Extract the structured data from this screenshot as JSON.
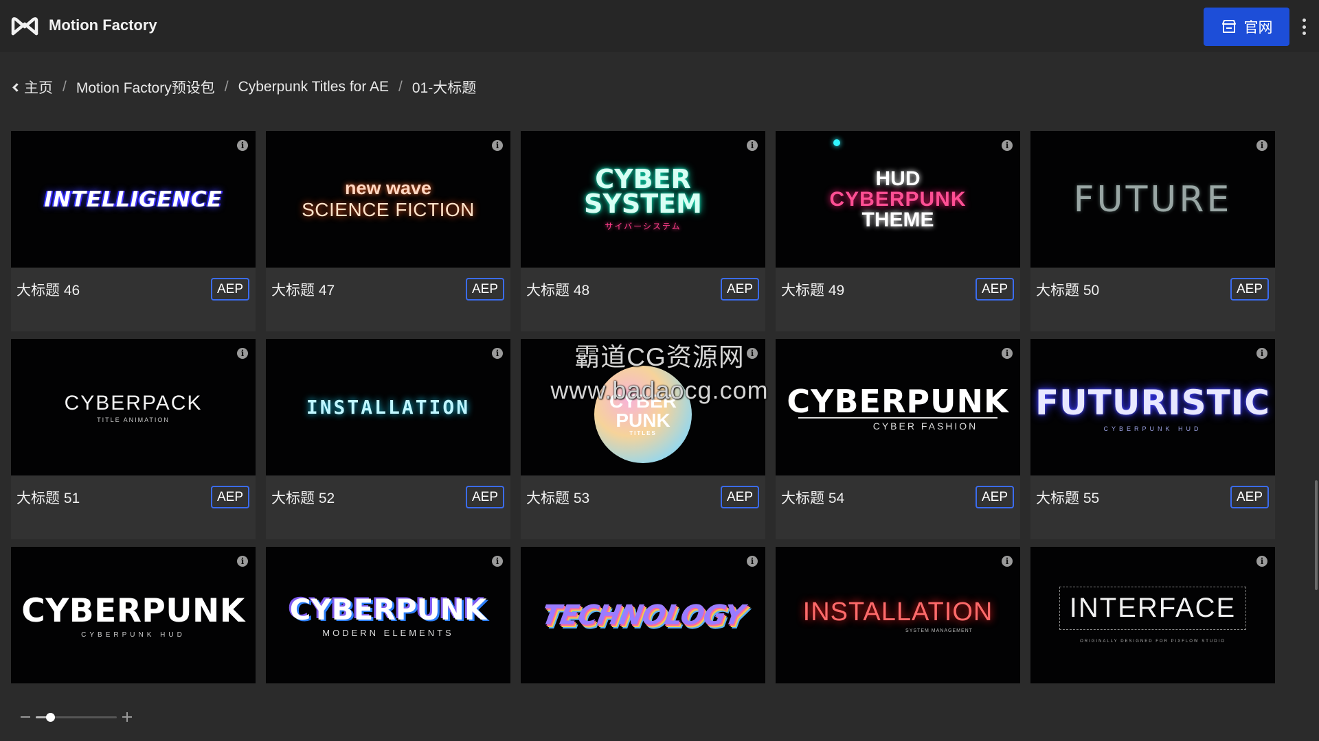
{
  "app": {
    "title": "Motion Factory"
  },
  "header": {
    "site_button_label": "官网",
    "site_icon": "store-icon",
    "menu_icon": "more-vertical-icon"
  },
  "breadcrumb": [
    {
      "label": "主页"
    },
    {
      "label": "Motion Factory预设包"
    },
    {
      "label": "Cyberpunk Titles for AE"
    },
    {
      "label": "01-大标题"
    }
  ],
  "cards": [
    {
      "title": "大标题 46",
      "badge": "AEP",
      "thumb": [
        "INTELLIGENCE"
      ]
    },
    {
      "title": "大标题 47",
      "badge": "AEP",
      "thumb": [
        "new wave",
        "SCIENCE FICTION"
      ]
    },
    {
      "title": "大标题 48",
      "badge": "AEP",
      "thumb": [
        "CYBER",
        "SYSTEM",
        "サイバーシステム"
      ]
    },
    {
      "title": "大标题 49",
      "badge": "AEP",
      "thumb": [
        "HUD",
        "CYBERPUNK",
        "THEME"
      ]
    },
    {
      "title": "大标题 50",
      "badge": "AEP",
      "thumb": [
        "FUTURE"
      ]
    },
    {
      "title": "大标题 51",
      "badge": "AEP",
      "thumb": [
        "CYBERPACK",
        "TITLE ANIMATION"
      ]
    },
    {
      "title": "大标题 52",
      "badge": "AEP",
      "thumb": [
        "INSTALLATION"
      ]
    },
    {
      "title": "大标题 53",
      "badge": "AEP",
      "thumb": [
        "CYBER",
        "PUNK",
        "TITLES"
      ]
    },
    {
      "title": "大标题 54",
      "badge": "AEP",
      "thumb": [
        "CYBERPUNK",
        "CYBER FASHION"
      ]
    },
    {
      "title": "大标题 55",
      "badge": "AEP",
      "thumb": [
        "FUTURISTIC",
        "CYBERPUNK HUD"
      ]
    },
    {
      "title": "",
      "badge": "",
      "thumb": [
        "CYBERPUNK",
        "CYBERPUNK HUD"
      ]
    },
    {
      "title": "",
      "badge": "",
      "thumb": [
        "CYBERPUNK",
        "MODERN ELEMENTS"
      ]
    },
    {
      "title": "",
      "badge": "",
      "thumb": [
        "TECHNOLOGY"
      ]
    },
    {
      "title": "",
      "badge": "",
      "thumb": [
        "INSTALLATION",
        "SYSTEM MANAGEMENT"
      ]
    },
    {
      "title": "",
      "badge": "",
      "thumb": [
        "INTERFACE",
        "ORIGINALLY DESIGNED FOR PIXFLOW STUDIO"
      ]
    }
  ],
  "info_icon_glyph": "i",
  "watermark": {
    "line1": "霸道CG资源网",
    "line2": "www.badaocg.com"
  },
  "zoom": {
    "level": 0.18
  },
  "colors": {
    "accent": "#1d4ed8",
    "badge_border": "#3b6cf0",
    "background": "#2b2b2b",
    "card": "#323232"
  }
}
